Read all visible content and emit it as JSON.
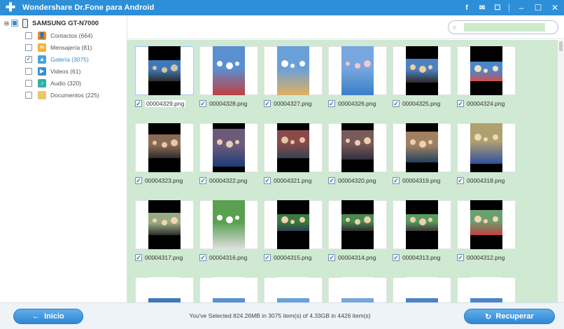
{
  "window": {
    "title": "Wondershare Dr.Fone para Android",
    "icons": [
      "facebook-icon",
      "feedback-icon",
      "chat-icon",
      "minimize-icon",
      "restore-icon",
      "close-icon"
    ]
  },
  "sidebar": {
    "device": "SAMSUNG GT-N7000",
    "items": [
      {
        "label": "Contactos (664)",
        "checked": false,
        "icon": "contacts-icon",
        "color": "#f08a24"
      },
      {
        "label": "Mensajería (81)",
        "checked": false,
        "icon": "messages-icon",
        "color": "#f2b13a"
      },
      {
        "label": "Galería (3075)",
        "checked": true,
        "icon": "gallery-icon",
        "color": "#4aa3df"
      },
      {
        "label": "Videos (61)",
        "checked": false,
        "icon": "video-icon",
        "color": "#3a8fd8"
      },
      {
        "label": "Audio (320)",
        "checked": false,
        "icon": "audio-icon",
        "color": "#2db3a0"
      },
      {
        "label": "Documentos (225)",
        "checked": false,
        "icon": "folder-icon",
        "color": "#e9c86a"
      }
    ]
  },
  "search": {
    "placeholder": ""
  },
  "grid": {
    "files": [
      "00004329.png",
      "00004328.png",
      "00004327.png",
      "00004326.png",
      "00004325.png",
      "00004324.png",
      "00004323.png",
      "00004322.png",
      "00004321.png",
      "00004320.png",
      "00004319.png",
      "00004318.png",
      "00004317.png",
      "00004316.png",
      "00004315.png",
      "00004314.png",
      "00004313.png",
      "00004312.png",
      "",
      "",
      "",
      "",
      "",
      ""
    ]
  },
  "footer": {
    "back_label": "Inicio",
    "status": "You've Selected 824.26MB in 3075 item(s) of 4.33GB in 4426 item(s)",
    "recover_label": "Recuperar"
  },
  "colors": {
    "accent": "#2d8fd8",
    "grid_bg": "#cfe9d2"
  }
}
